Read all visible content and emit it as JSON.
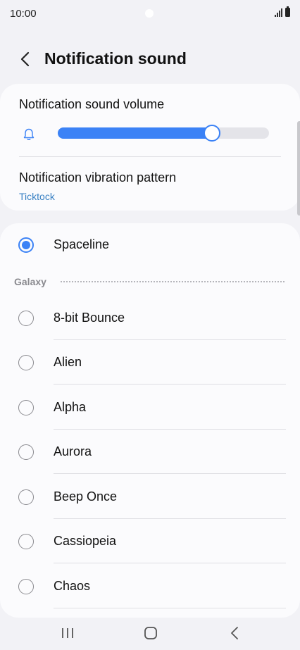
{
  "status_bar": {
    "time": "10:00"
  },
  "header": {
    "title": "Notification sound"
  },
  "volume": {
    "label": "Notification sound volume",
    "level": 0.73
  },
  "vibration": {
    "label": "Notification vibration pattern",
    "value": "Ticktock"
  },
  "selected_sound": {
    "label": "Spaceline",
    "checked": true
  },
  "section": {
    "label": "Galaxy"
  },
  "sounds": [
    {
      "label": "8-bit Bounce",
      "checked": false
    },
    {
      "label": "Alien",
      "checked": false
    },
    {
      "label": "Alpha",
      "checked": false
    },
    {
      "label": "Aurora",
      "checked": false
    },
    {
      "label": "Beep Once",
      "checked": false
    },
    {
      "label": "Cassiopeia",
      "checked": false
    },
    {
      "label": "Chaos",
      "checked": false
    }
  ],
  "colors": {
    "accent": "#3b82f6",
    "link": "#3b82c4",
    "background": "#f2f2f6",
    "card": "#fbfbfd"
  },
  "icons": {
    "back": "chevron-left-icon",
    "bell": "bell-icon",
    "nav_recents": "recents-icon",
    "nav_home": "home-icon",
    "nav_back": "back-icon"
  }
}
